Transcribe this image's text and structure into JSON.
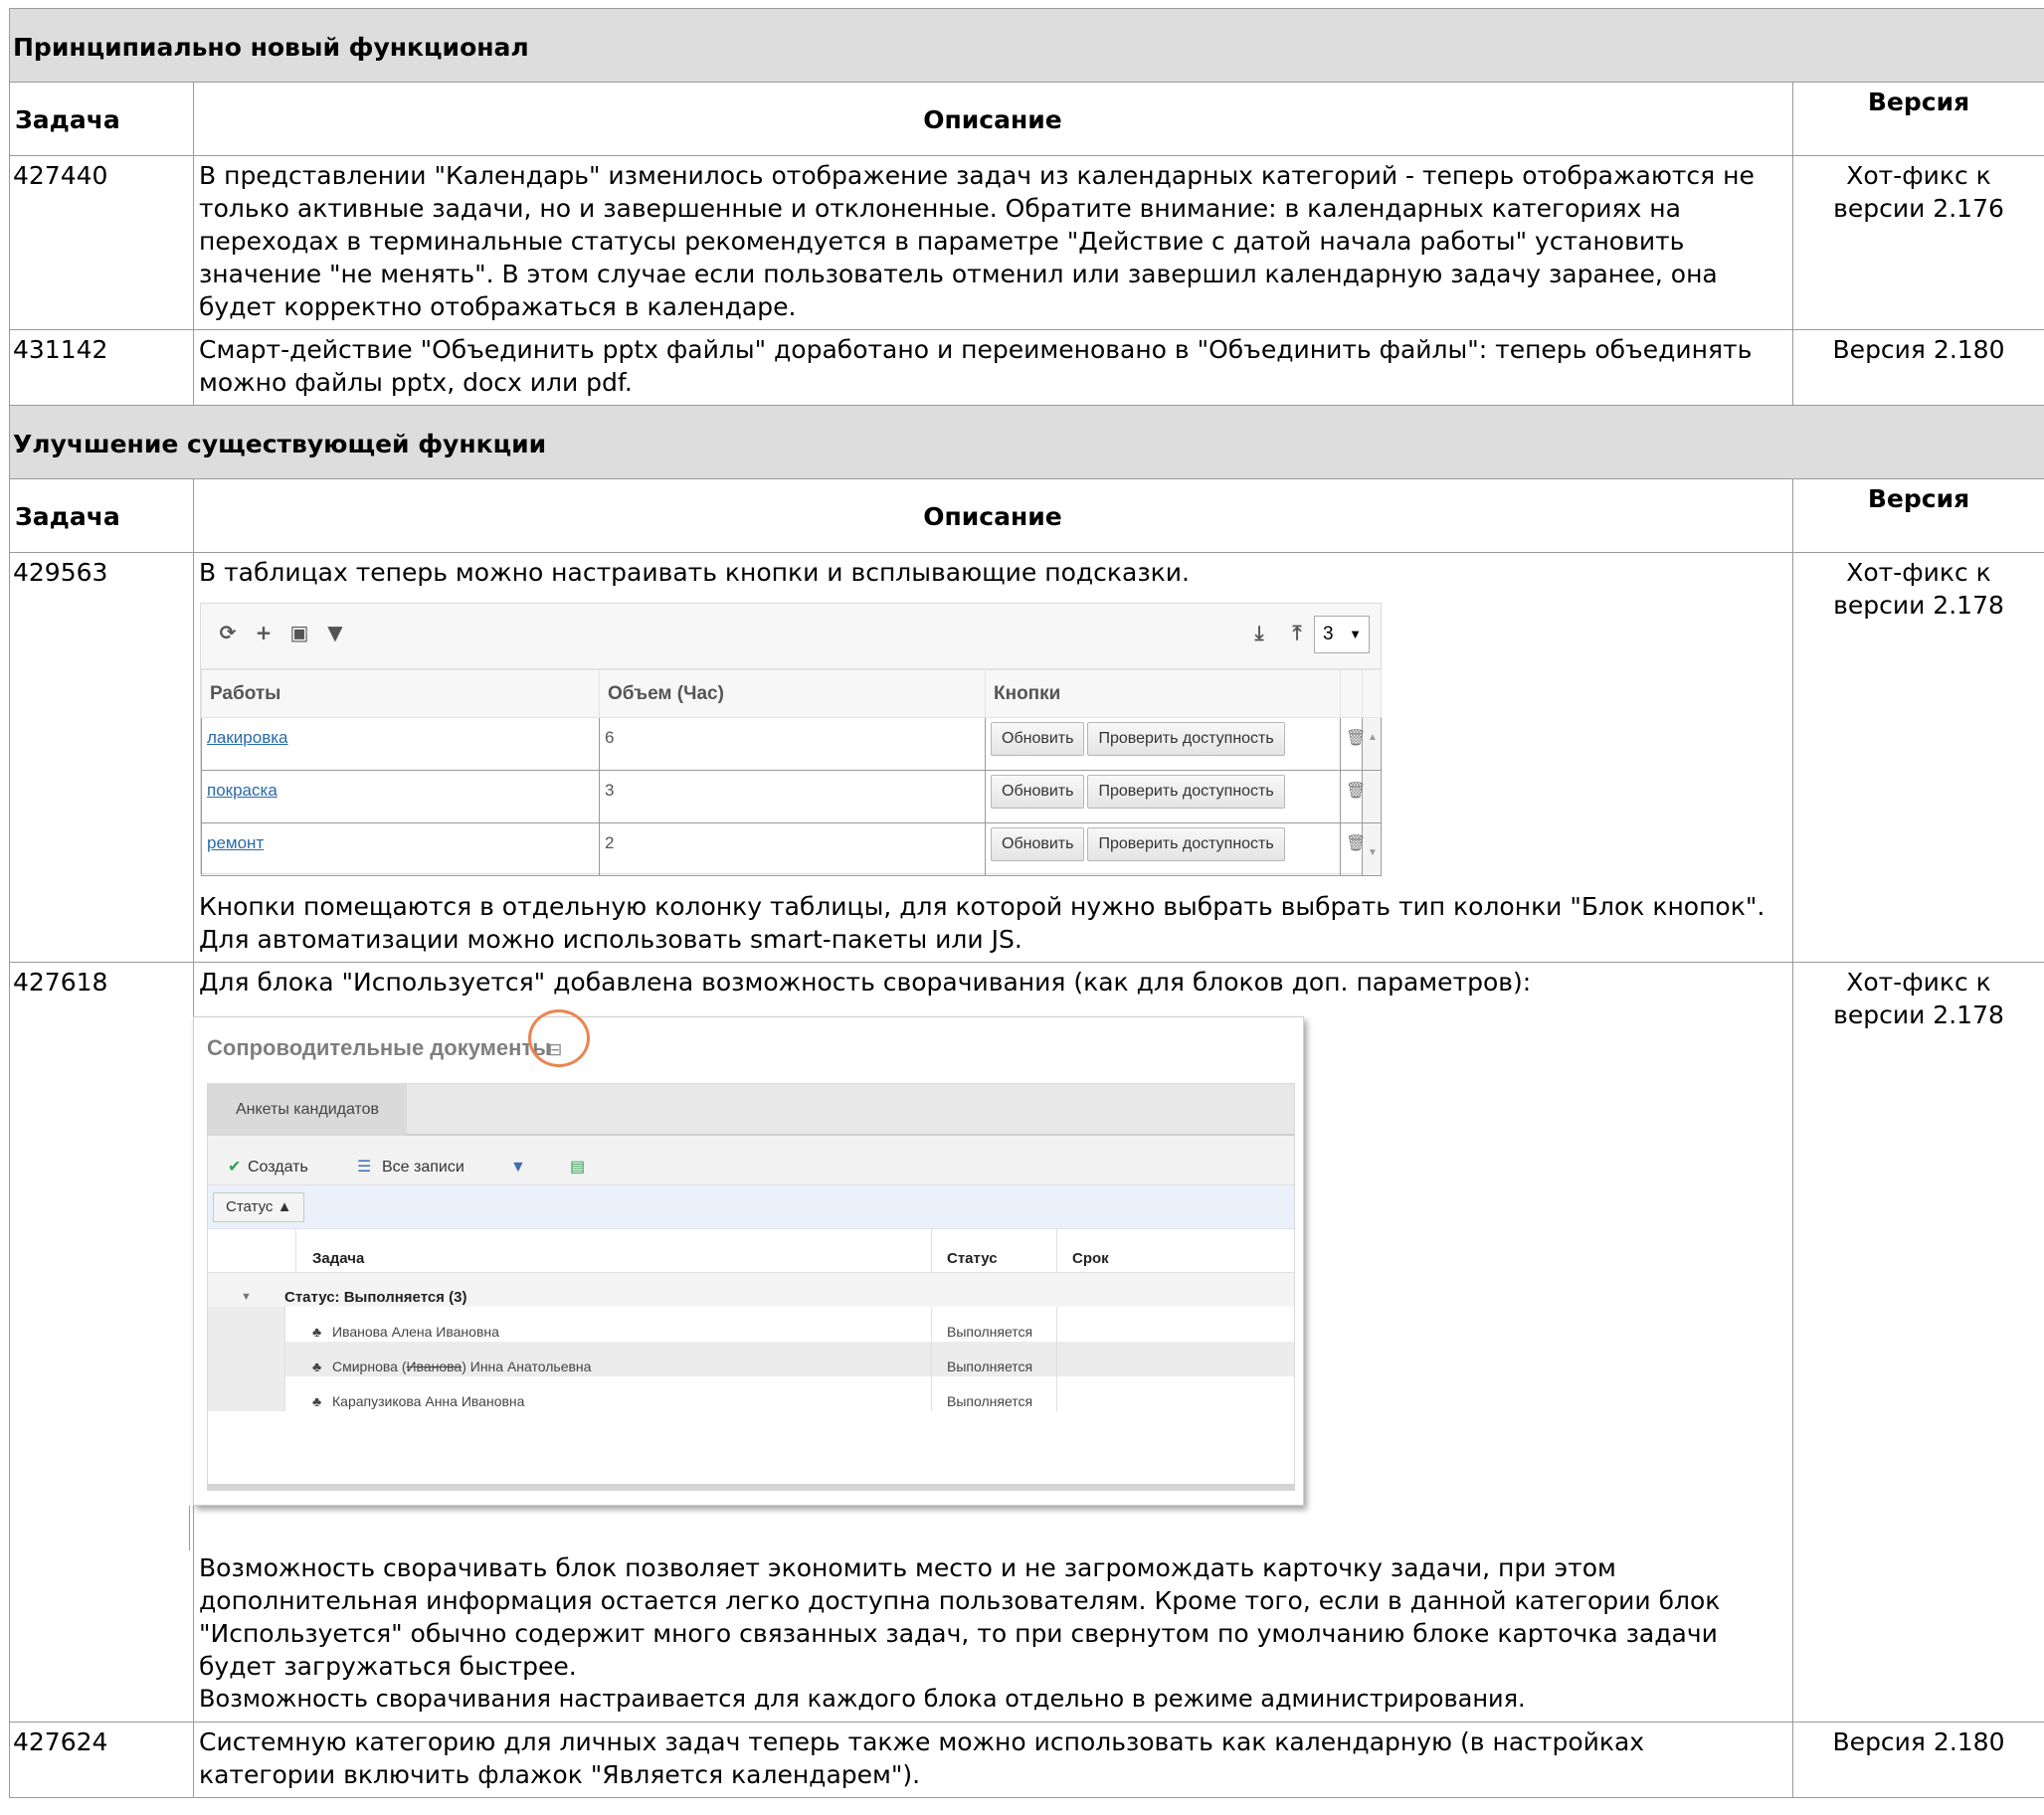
{
  "section1": {
    "title": "Принципиально новый функционал",
    "headers": {
      "task": "Задача",
      "description": "Описание",
      "version": "Версия"
    },
    "rows": [
      {
        "task": "427440",
        "description": "В представлении \"Календарь\" изменилось отображение задач из календарных категорий - теперь отображаются не только активные задачи, но и завершенные и отклоненные. Обратите внимание: в календарных категориях на переходах в терминальные статусы рекомендуется в параметре \"Действие с датой начала работы\" установить значение \"не менять\". В этом случае если пользователь отменил или завершил календарную задачу заранее, она будет корректно отображаться в календаре.",
        "version": "Хот-фикс к версии 2.176"
      },
      {
        "task": "431142",
        "description": "Смарт-действие \"Объединить pptx файлы\" доработано и переименовано в \"Объединить файлы\": теперь объединять можно файлы pptx, docx или pdf.",
        "version": "Версия 2.180"
      }
    ]
  },
  "section2": {
    "title": "Улучшение существующей функции",
    "headers": {
      "task": "Задача",
      "description": "Описание",
      "version": "Версия"
    },
    "row1": {
      "task": "429563",
      "intro": "В таблицах теперь можно настраивать кнопки и всплывающие подсказки.",
      "after": "Кнопки помещаются в отдельную колонку таблицы, для которой нужно выбрать выбрать тип колонки \"Блок кнопок\". Для автоматизации можно использовать smart-пакеты или JS.",
      "version": "Хот-фикс к версии 2.178",
      "screenshot": {
        "page_size": "3",
        "columns": [
          "Работы",
          "Объем (Час)",
          "Кнопки"
        ],
        "rows": [
          {
            "work": "лакировка",
            "volume": "6"
          },
          {
            "work": "покраска",
            "volume": "3"
          },
          {
            "work": "ремонт",
            "volume": "2"
          }
        ],
        "btn_update": "Обновить",
        "btn_check": "Проверить доступность"
      }
    },
    "row2": {
      "task": "427618",
      "intro": "Для блока \"Используется\" добавлена возможность сворачивания (как для блоков доп. параметров):",
      "after": "Возможность сворачивать блок позволяет экономить место и не загромождать карточку задачи, при этом дополнительная информация остается легко доступна пользователям. Кроме того, если в данной категории блок \"Используется\" обычно содержит много связанных задач, то при свернутом по умолчанию блоке карточка задачи будет загружаться быстрее.",
      "after2": "Возможность сворачивания настраивается для каждого блока отдельно в режиме администрирования.",
      "version": "Хот-фикс к версии 2.178",
      "screenshot": {
        "block_title": "Сопроводительные документы",
        "tab": "Анкеты кандидатов",
        "create": "Создать",
        "all_records": "Все записи",
        "group_chip": "Статус",
        "col_task": "Задача",
        "col_status": "Статус",
        "col_due": "Срок",
        "group_label": "Статус: Выполняется (3)",
        "rows": [
          {
            "name": "Иванова Алена Ивановна",
            "status": "Выполняется"
          },
          {
            "name_a": "Смирнова (",
            "name_strike": "Иванова",
            "name_b": ") Инна Анатольевна",
            "status": "Выполняется"
          },
          {
            "name": "Карапузикова Анна Ивановна",
            "status": "Выполняется"
          }
        ]
      }
    },
    "row3": {
      "task": "427624",
      "description": "Системную категорию для личных задач теперь также можно использовать как календарную (в настройках категории включить флажок \"Является календарем\").",
      "version": "Версия 2.180"
    }
  }
}
